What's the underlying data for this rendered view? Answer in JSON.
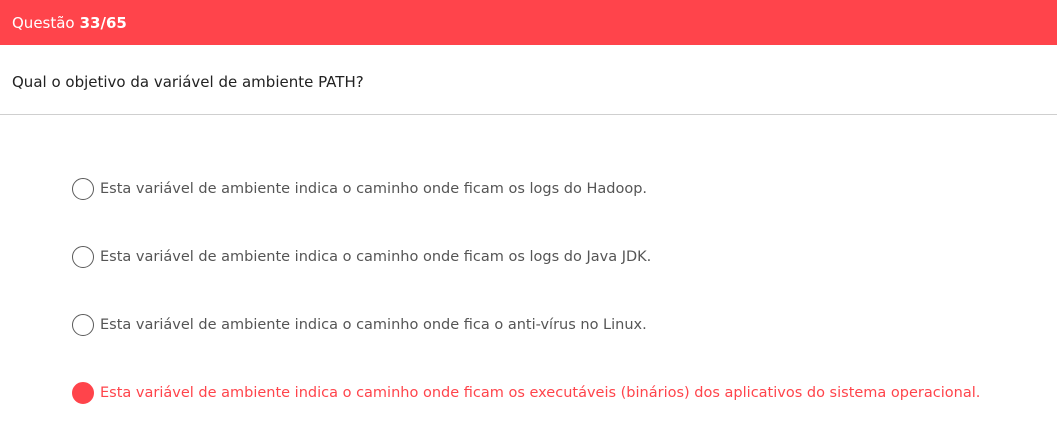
{
  "header": {
    "prefix": "Questão",
    "counter": "33/65",
    "background_color": "#ff444b"
  },
  "question": {
    "text": "Qual o objetivo da variável de ambiente PATH?"
  },
  "options": [
    {
      "label": "Esta variável de ambiente indica o caminho onde ficam os logs do Hadoop.",
      "selected": false
    },
    {
      "label": "Esta variável de ambiente indica o caminho onde ficam os logs do Java JDK.",
      "selected": false
    },
    {
      "label": "Esta variável de ambiente indica o caminho onde fica o anti-vírus no Linux.",
      "selected": false
    },
    {
      "label": "Esta variável de ambiente indica o caminho onde ficam os executáveis (binários) dos aplicativos do sistema operacional.",
      "selected": true
    }
  ],
  "colors": {
    "accent": "#ff444b",
    "option_text": "#555555",
    "question_text": "#222222"
  }
}
